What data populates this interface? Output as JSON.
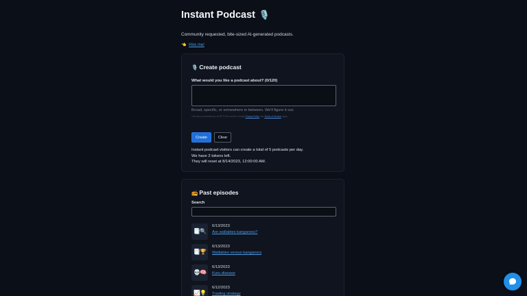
{
  "header": {
    "title": "Instant Podcast",
    "title_icon": "microphone-emoji",
    "subtitle": "Community requested, bite-sized AI-generated podcasts.",
    "hire_icon": "pointing-hand-emoji",
    "hire_link": "Hire me!"
  },
  "create": {
    "title": "Create podcast",
    "title_icon": "microphone-emoji",
    "prompt_label": "What would you like a podcast about? (0/120)",
    "prompt_value": "",
    "hint": "Broad, specific, or somewhere in between. We'll figure it out.",
    "recaptcha_prefix": "This site is protected by reCAPTCHA and the Google",
    "privacy_link": "Privacy Policy",
    "recaptcha_and": "and",
    "terms_link": "Terms of Service",
    "recaptcha_suffix": "apply.",
    "create_label": "Create",
    "clear_label": "Clear",
    "info_line1": "Instant podcast visitors can create a total of 5 podcasts per day.",
    "info_line2": "We have 2 tokens left.",
    "info_line3": "They will reset at 8/14/2023, 12:00:00 AM."
  },
  "past": {
    "title": "Past episodes",
    "title_icon": "radio-emoji",
    "search_label": "Search",
    "search_value": "",
    "episodes": [
      {
        "date": "6/13/2023",
        "title": "Are wallabies kangaroos?",
        "thumb": "📑🔍"
      },
      {
        "date": "6/13/2023",
        "title": "Wallabies versus kangaroos",
        "thumb": "📑🏆"
      },
      {
        "date": "6/13/2023",
        "title": "Kuru disease",
        "thumb": "💀🧠"
      },
      {
        "date": "6/12/2023",
        "title": "Trading strategy",
        "thumb": "📈💡"
      }
    ]
  },
  "colors": {
    "background": "#0b0f17",
    "card": "#0f141e",
    "accent": "#1f6fd9",
    "link": "#4b9be8",
    "chat_button": "#1f8fe8"
  }
}
